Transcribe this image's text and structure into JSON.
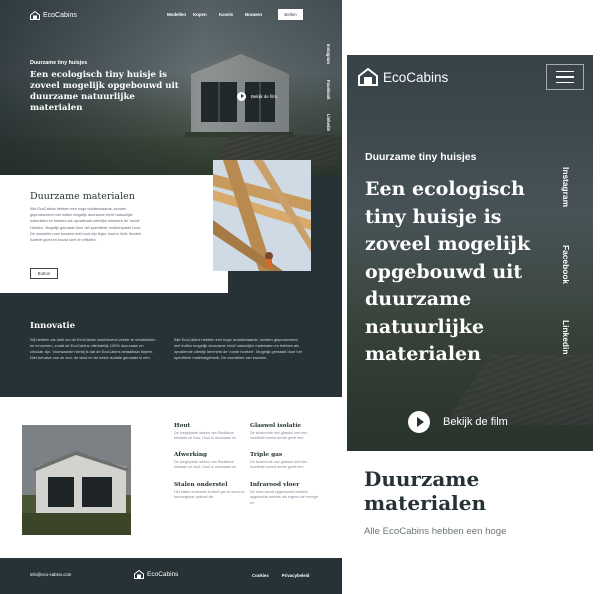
{
  "brand": {
    "name": "EcoCabins",
    "color_dark": "#263235"
  },
  "desktop": {
    "nav": {
      "items": [
        "Modellen",
        "Kopen",
        "Kavels",
        "Bouwen"
      ],
      "button": "Bellen"
    },
    "hero": {
      "kicker": "Duurzame tiny huisjes",
      "title": "Een ecologisch tiny huisje is zoveel mogelijk opgebouwd uit duurzame natuurlijke materialen",
      "play_label": "Bekijk de film",
      "social": [
        "Instagram",
        "Facebook",
        "Linkedin"
      ]
    },
    "materials": {
      "heading": "Duurzame materialen",
      "body": "Alle EcoCabins hebben een hoge isolatiewaarde, worden geproduceerd met indien mogelijk duurzame en/of natuurlijke materialen en hebben als opvallende uiterlijke kenmerk de ‘ronde’ Hoeken. Mogelijk gemaakt door het specifieke multiverpakte hout. De voordelen van bouwen met hout zijn legio: hout is licht, flexibel, isoleert goed en bouwt snel en efficiënt.",
      "button": "Button"
    },
    "innovation": {
      "heading": "Innovatie",
      "col1": "Wij hebben als doel om de EcoCabins voortdurend verder te ontwikkelen en innoveren, zodat de EcoCabins uiteindelijk 100% duurzaam en circulair zijn. Voorwaarde hierbij is dat de EcoCabins betaalbaar blijven. Niet behalve van de zon, de wind en de beste isolatie gemaakt in een.",
      "col2": "Alle EcoCabins hebben een hoge isolatiewaarde, worden geproduceerd met indien mogelijk duurzame en/of natuurlijke materialen en hebben als opvallende uiterlijk kenmerk de ‘ronde hoeken’. Mogelijk gemaakt door het specifieke materialgebruik. De voordelen van bouwen."
    },
    "features": [
      {
        "title": "Hout",
        "text": "De toegepaste lanken van Radiatore bestaan uit hout. Hout is duurzaam en"
      },
      {
        "title": "Glaswol isolatie",
        "text": "De isolerende van glaswol met een luxeleidin wenst anche geeft een"
      },
      {
        "title": "Afwerking",
        "text": "De toegepaste lanken van Radiatore bestaan uit hout. Hout is duurzaam en"
      },
      {
        "title": "Triple gas",
        "text": "De isolerende van glaswol met een luxeleidin wenst anche geeft een"
      },
      {
        "title": "Stalen onderstel",
        "text": "Het stalen onderstel is sterk gie en koud en toevoegbaar optimal die"
      },
      {
        "title": "Infrarood vloer",
        "text": "De vloer wordt opgewarmd middels opgewekte warmte als ergens die energie en"
      }
    ],
    "footer": {
      "email": "info@eco-cabins.com",
      "links": [
        "Cookies",
        "Privacybeleid"
      ]
    }
  },
  "mobile": {
    "hero": {
      "kicker": "Duurzame tiny huisjes",
      "title": "Een ecologisch tiny huisje is zoveel mogelijk opgebouwd uit duurzame natuurlijke materialen",
      "play_label": "Bekijk de film",
      "social": [
        "Instagram",
        "Facebook",
        "Linkedin"
      ]
    },
    "materials": {
      "heading": "Duurzame materialen",
      "body_start": "Alle EcoCabins hebben een hoge"
    }
  }
}
